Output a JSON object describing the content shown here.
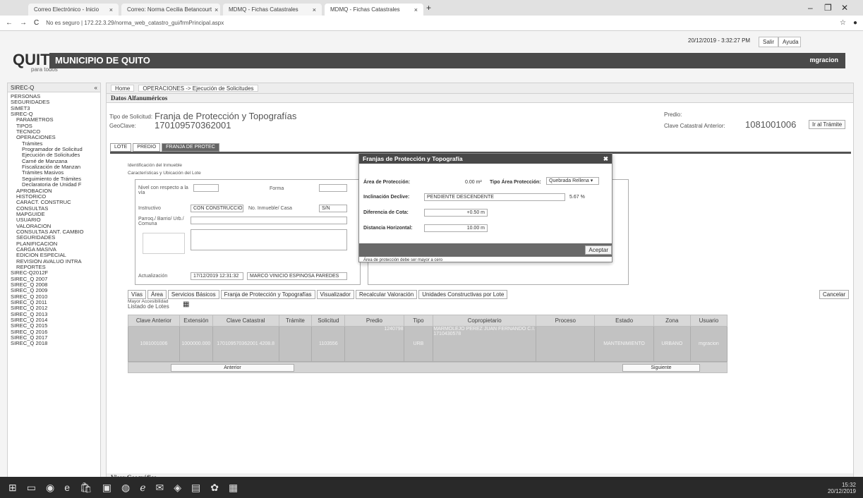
{
  "browser": {
    "tabs": [
      {
        "label": "Correo Electrónico - Inicio"
      },
      {
        "label": "Correo: Norma Cecilia Betancourt"
      },
      {
        "label": "MDMQ - Fichas Catastrales"
      },
      {
        "label": "MDMQ - Fichas Catastrales"
      }
    ],
    "url": "No es seguro | 172.22.3.29/norma_web_catastro_gui/frmPrincipal.aspx",
    "min": "–",
    "max": "❐",
    "close": "✕"
  },
  "header": {
    "logo": "QUITO",
    "logo_sub": "para todos",
    "title": "MUNICIPIO DE QUITO",
    "datetime": "20/12/2019 - 3:32:27 PM",
    "salir": "Salir",
    "ayuda": "Ayuda",
    "user": "mgracion"
  },
  "sidebar": {
    "title": "SIREC-Q",
    "items": [
      "PERSONAS",
      "SEGURIDADES",
      "SIMET3",
      "SIREC-Q",
      "PARAMETROS",
      "TIPOS",
      "TECNICO",
      "OPERACIONES",
      "Trámites",
      "Programador de Solicitud",
      "Ejecución de Solicitudes",
      "Carné de Manzana",
      "Fiscalización de Manzan",
      "Trámites Masivos",
      "Seguimiento de Trámites",
      "Declaratoria de Unidad F",
      "APROBACION",
      "HISTÓRICO",
      "CARACT. CONSTRUC",
      "CONSULTAS",
      "MAPGUIDE",
      "USUARIO",
      "VALORACIÓN",
      "CONSULTAS ANT. CAMBIO",
      "SEGURIDADES",
      "PLANIFICACIÓN",
      "CARGA MASIVA",
      "EDICION ESPECIAL",
      "REVISIÓN AVALUO INTRA",
      "REPORTES",
      "SIREC-Q2012F",
      "SIREC_Q 2007",
      "SIREC_Q 2008",
      "SIREC_Q 2009",
      "SIREC_Q 2010",
      "SIREC_Q 2011",
      "SIREC_Q 2012",
      "SIREC_Q 2013",
      "SIREC_Q 2014",
      "SIREC_Q 2015",
      "SIREC_Q 2016",
      "SIREC_Q 2017",
      "SIREC_Q 2018"
    ]
  },
  "main": {
    "tabs": [
      "Home",
      "OPERACIONES -> Ejecución de Solicitudes"
    ],
    "section_title": "Datos Alfanuméricos",
    "tipo_label": "Tipo de Solicitud:",
    "tipo_value": "Franja de Protección y Topografías",
    "geo_label": "GeoClave:",
    "geo_value": "170109570362001",
    "predio_label": "Predio:",
    "clave_ant_label": "Clave Catastral Anterior:",
    "clave_ant_value": "1081001006",
    "ir_tramite": "Ir al Trámite",
    "subtabs": [
      "LOTE",
      "PREDIO",
      "FRANJA DE PROTEC"
    ],
    "id_inmueble": "Identificación del Inmueble",
    "caract": "Características y Ubicación del Lote",
    "nivel_label": "Nivel con respecto a la vía",
    "forma_label": "Forma",
    "instructivo_label": "Instructivo",
    "instructivo_value": "CON CONSTRUCCIÓN",
    "num_label": "No. Inmueble/ Casa",
    "num_value": "S/N",
    "parroq_label": "Parroq./ Barrio/ Urb./ Comuna",
    "actualiz_label": "Actualización",
    "actualiz_value": "17/12/2019 12:31:32",
    "actualiz_user": "MARCO VINICIO ESPINOSA PAREDES",
    "mayor_acc": "Mayor Accesibilidad",
    "detail_buttons": [
      "Vías",
      "Área",
      "Servicios Básicos",
      "Franja de Protección y Topografías",
      "Visualizador",
      "Recalcular Valoración",
      "Unidades Constructivas por Lote"
    ],
    "cancelar": "Cancelar",
    "lotes_label": "Listado de Lotes",
    "columns": [
      "Clave Anterior",
      "Extensión",
      "Clave Catastral",
      "Trámite",
      "Solicitud",
      "Predio",
      "Tipo",
      "Copropietario",
      "Proceso",
      "Estado",
      "Zona",
      "Usuario"
    ],
    "row": [
      "1081001006",
      "1000000.000",
      "170109570362001 4208.8",
      "",
      "1103556",
      "",
      "URB",
      "",
      "",
      "MANTENIMIENTO",
      "URBANO",
      "mgracion"
    ],
    "owner_id": "1240798",
    "owner_name": "MARMOLEJO PEREZ JUAN FERNANDO C.I. 1710430578",
    "anterior": "Anterior",
    "siguiente": "Siguiente",
    "visor": "Visor Geográfico"
  },
  "dialog": {
    "title": "Franjas de Protección y Topografía",
    "close": "✖",
    "area_label": "Área de Protección:",
    "area_value": "0.00 m²",
    "tipo_area_label": "Tipo Área Protección:",
    "tipo_area_value": "Quebrada Rellena",
    "inclinacion_label": "Inclinación Declive:",
    "inclinacion_value": "PENDIENTE DESCENDENTE",
    "inclinacion_pct": "5.67 %",
    "dif_cota_label": "Diferencia de Cota:",
    "dif_cota_value": "+0.50 m",
    "dist_label": "Distancia Horizontal:",
    "dist_value": "10.00 m",
    "aceptar": "Aceptar",
    "note": "Área de protección debe ser mayor a cero"
  },
  "taskbar": {
    "time": "15:32",
    "date": "20/12/2019"
  }
}
